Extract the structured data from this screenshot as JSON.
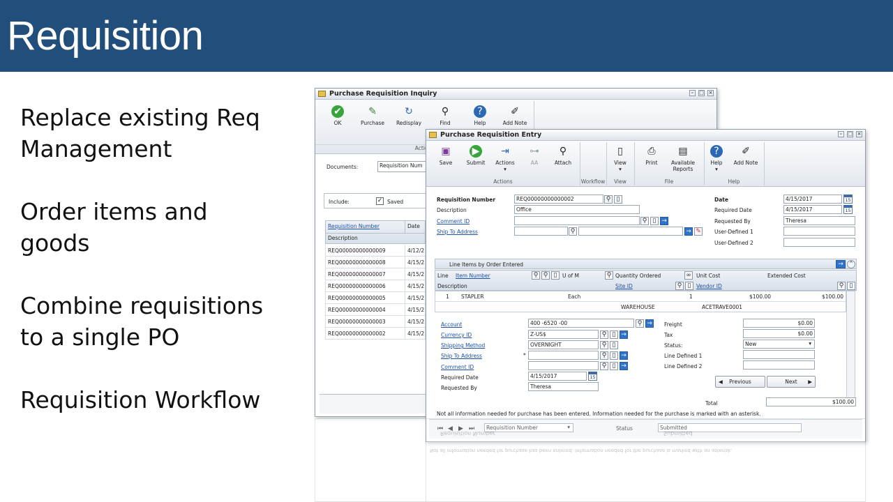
{
  "slide": {
    "title": "Requisition",
    "bullets": [
      "Replace existing Req\nManagement",
      "Order items and\ngoods",
      "Combine requisitions\nto a single PO",
      "Requisition Workflow"
    ]
  },
  "inquiry": {
    "title": "Purchase Requisition Inquiry",
    "ribbon": {
      "buttons": [
        "OK",
        "Purchase",
        "Redisplay",
        "Find",
        "Help",
        "Add Note"
      ],
      "group": "Actions"
    },
    "documents_label": "Documents:",
    "documents_value": "Requisition Num",
    "include_label": "Include:",
    "saved_label": "Saved",
    "col_req": "Requisition Number",
    "col_date": "Date",
    "col_desc": "Description",
    "rows": [
      {
        "req": "REQ00000000000009",
        "date": "4/12/2"
      },
      {
        "req": "REQ00000000000008",
        "date": "4/15/2"
      },
      {
        "req": "REQ00000000000007",
        "date": "4/15/2"
      },
      {
        "req": "REQ00000000000006",
        "date": "4/15/2"
      },
      {
        "req": "REQ00000000000005",
        "date": "4/15/2"
      },
      {
        "req": "REQ00000000000004",
        "date": "4/15/2"
      },
      {
        "req": "REQ00000000000003",
        "date": "4/15/2"
      },
      {
        "req": "REQ00000000000002",
        "date": "4/15/2"
      }
    ]
  },
  "entry": {
    "title": "Purchase Requisition Entry",
    "ribbon": {
      "save": "Save",
      "submit": "Submit",
      "actions": "Actions",
      "aa": "AA",
      "attach": "Attach",
      "view": "View",
      "print": "Print",
      "available_reports": "Available\nReports",
      "help": "Help",
      "add_note": "Add Note",
      "groups": {
        "actions": "Actions",
        "workflow": "Workflow",
        "view": "View",
        "file": "File",
        "help": "Help"
      }
    },
    "header": {
      "req_number_label": "Requisition Number",
      "req_number": "REQ00000000000002",
      "description_label": "Description",
      "description": "Office",
      "comment_id_label": "Comment ID",
      "ship_to_label": "Ship To Address",
      "date_label": "Date",
      "date": "4/15/2017",
      "required_date_label": "Required Date",
      "required_date": "4/15/2017",
      "requested_by_label": "Requested By",
      "requested_by": "Theresa",
      "ud1_label": "User-Defined 1",
      "ud2_label": "User-Defined 2"
    },
    "lines": {
      "section": "Line Items by Order Entered",
      "cols": {
        "line": "Line",
        "item": "Item Number",
        "uom": "U of M",
        "qty": "Quantity Ordered",
        "unit_cost": "Unit Cost",
        "ext_cost": "Extended Cost",
        "desc": "Description",
        "site": "Site ID",
        "vendor": "Vendor ID"
      },
      "row": {
        "line": "1",
        "item": "STAPLER",
        "uom": "Each",
        "qty": "1",
        "unit_cost": "$100.00",
        "ext_cost": "$100.00",
        "site": "WAREHOUSE",
        "vendor": "ACETRAVE0001"
      }
    },
    "detail": {
      "account_label": "Account",
      "account": "400 -6520 -00",
      "currency_label": "Currency ID",
      "currency": "Z-US$",
      "shipping_label": "Shipping Method",
      "shipping": "OVERNIGHT",
      "ship_to_label": "Ship To Address",
      "ship_to_star": "*",
      "comment_label": "Comment ID",
      "req_date_label": "Required Date",
      "req_date": "4/15/2017",
      "requested_by_label": "Requested By",
      "requested_by": "Theresa",
      "freight_label": "Freight",
      "freight": "$0.00",
      "tax_label": "Tax",
      "tax": "$0.00",
      "status_label": "Status:",
      "status": "New",
      "ld1_label": "Line Defined 1",
      "ld2_label": "Line Defined 2",
      "previous": "Previous",
      "next": "Next"
    },
    "total_label": "Total",
    "total": "$100.00",
    "notice": "Not all information needed for purchase has been entered. Information needed for the purchase is marked with an asterisk.",
    "footer": {
      "nav": "Requisition Number",
      "status_label": "Status",
      "status": "Submitted"
    },
    "calendar_day": "15"
  }
}
